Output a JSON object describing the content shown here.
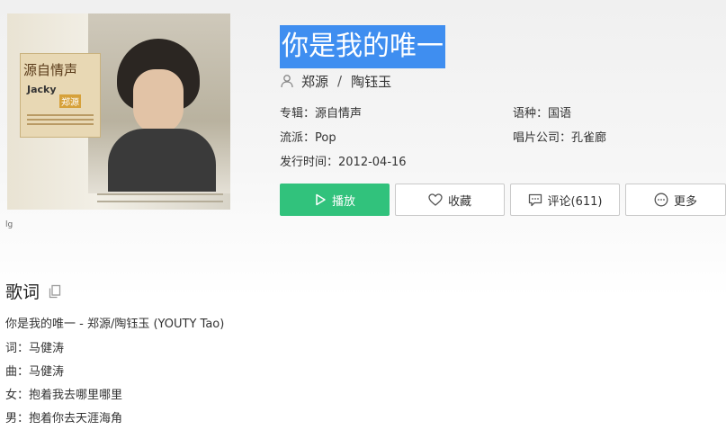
{
  "song": {
    "title": "你是我的唯一",
    "artists": [
      "郑源",
      "陶钰玉"
    ],
    "artist_separator": "/"
  },
  "cover": {
    "text_main": "源自情声",
    "text_name_en": "Jacky",
    "text_name_cn": "郑源",
    "broken_image_text": "lg"
  },
  "details": {
    "album": "专辑：源自情声",
    "language": "语种：国语",
    "genre": "流派：Pop",
    "label": "唱片公司：孔雀廊",
    "release": "发行时间：2012-04-16"
  },
  "buttons": {
    "play": "播放",
    "favorite": "收藏",
    "comments": "评论(611)",
    "more": "更多"
  },
  "lyrics": {
    "heading": "歌词",
    "lines": [
      "你是我的唯一 - 郑源/陶钰玉 (YOUTY Tao)",
      "词：马健涛",
      "曲：马健涛",
      "女：抱着我去哪里哪里",
      "男：抱着你去天涯海角"
    ]
  },
  "colors": {
    "accent_green": "#31c27c",
    "title_highlight": "#3f8ef0"
  }
}
